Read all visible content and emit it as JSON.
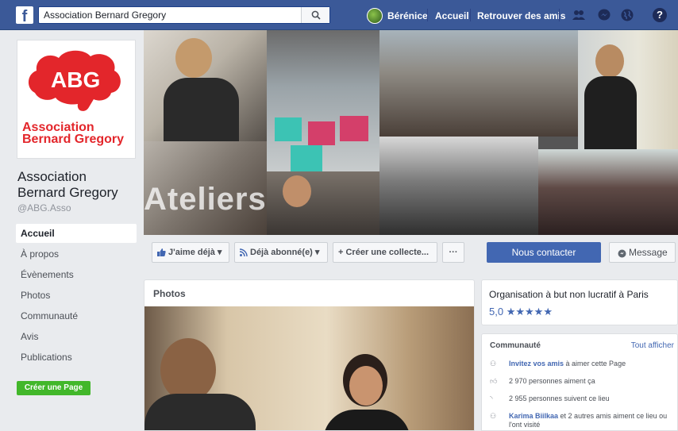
{
  "topbar": {
    "search_value": "Association Bernard Gregory",
    "user_name": "Bérénice",
    "links": {
      "home": "Accueil",
      "find_friends": "Retrouver des amis"
    },
    "help": "?"
  },
  "sidebar": {
    "logo_text": "ABG",
    "logo_wordmark_1": "Association",
    "logo_wordmark_2": "Bernard Gregory",
    "page_name": "Association Bernard Gregory",
    "handle": "@ABG.Asso",
    "items": [
      {
        "label": "Accueil",
        "active": true
      },
      {
        "label": "À propos"
      },
      {
        "label": "Évènements"
      },
      {
        "label": "Photos"
      },
      {
        "label": "Communauté"
      },
      {
        "label": "Avis"
      },
      {
        "label": "Publications"
      }
    ],
    "create_page": "Créer une Page"
  },
  "cover": {
    "overlay_text": "Ateliers"
  },
  "actions": {
    "like": "J'aime déjà",
    "follow": "Déjà abonné(e)",
    "fundraiser": "+ Créer une collecte...",
    "more": "···",
    "contact": "Nous contacter",
    "message": "Message"
  },
  "photos": {
    "title": "Photos"
  },
  "info": {
    "category": "Organisation à but non lucratif à Paris",
    "rating_value": "5,0",
    "stars": "★★★★★",
    "stars_filled": 5
  },
  "community": {
    "title": "Communauté",
    "see_all": "Tout afficher",
    "invite_link": "Invitez vos amis",
    "invite_rest": " à aimer cette Page",
    "likes": "2 970 personnes aiment ça",
    "follows": "2 955 personnes suivent ce lieu",
    "friend_name": "Karima Biilkaa",
    "friend_rest": " et 2 autres amis aiment ce lieu ou l'ont visité"
  },
  "colors": {
    "brand_blue": "#3b5998",
    "button_blue": "#4267b2",
    "green": "#42b72a",
    "abg_red": "#e3262b"
  }
}
